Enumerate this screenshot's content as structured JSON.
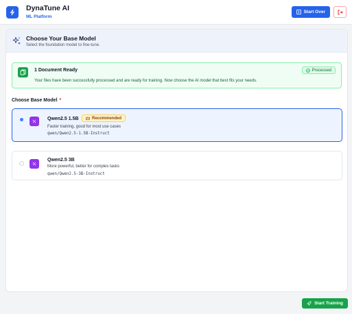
{
  "app": {
    "title": "DynaTune AI",
    "subtitle": "ML Platform",
    "brand_color": "#2563eb"
  },
  "header": {
    "start_over_label": "Start Over",
    "start_over_icon": "play-icon",
    "logout_icon": "logout-icon"
  },
  "section": {
    "icon": "sparkles-icon",
    "title": "Choose Your Base Model",
    "subtitle": "Select the foundation model to fine-tune."
  },
  "status": {
    "icon": "document-icon",
    "title": "1 Document Ready",
    "message": "Your files have been successfully processed and are ready for training. Now choose the AI model that best fits your needs.",
    "badge": "Processed",
    "color": "#16a34a"
  },
  "model_field": {
    "label": "Choose Base Model",
    "required_mark": "*"
  },
  "models": [
    {
      "name": "Qwen2.5 1.5B",
      "badge": "Recommended",
      "description": "Faster training, good for most use cases",
      "id": "qwen/Qwen2.5-1.5B-Instruct",
      "selected": true
    },
    {
      "name": "Qwen2.5 3B",
      "description": "More powerful, better for complex tasks",
      "id": "qwen/Qwen2.5-3B-Instruct",
      "selected": false
    }
  ],
  "footer": {
    "start_training_label": "Start Training",
    "start_training_icon": "rocket-icon"
  }
}
